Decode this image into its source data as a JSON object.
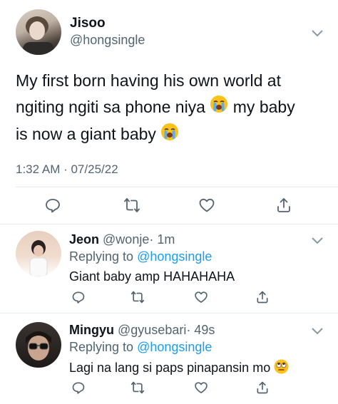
{
  "main_tweet": {
    "author_name": "Jisoo",
    "handle": "@hongsingle",
    "text_line1": "My first born having his own world at",
    "text_line2a": "ngiting ngiti sa phone niya",
    "text_line2b": "my baby",
    "text_line3": "is now a giant baby",
    "timestamp": "1:32 AM · 07/25/22"
  },
  "replies": [
    {
      "author_name": "Jeon",
      "handle": "@wonje",
      "time": "· 1m",
      "replying_label": "Replying to",
      "replying_handle": "@hongsingle",
      "text": "Giant baby amp HAHAHAHA"
    },
    {
      "author_name": "Mingyu",
      "handle": "@gyusebari",
      "time": "· 49s",
      "replying_label": "Replying to",
      "replying_handle": "@hongsingle",
      "text": "Lagi na lang si paps pinapansin mo"
    }
  ],
  "icons": {
    "reply": "reply-icon",
    "retweet": "retweet-icon",
    "like": "heart-icon",
    "share": "share-icon",
    "more": "chevron-down-icon",
    "emoji_cry": "loudly-crying-face-emoji",
    "emoji_eyeroll": "face-with-rolling-eyes-emoji"
  },
  "colors": {
    "text": "#0f1419",
    "muted": "#536471",
    "link": "#1d9bf0",
    "divider": "#e6ecf0"
  }
}
